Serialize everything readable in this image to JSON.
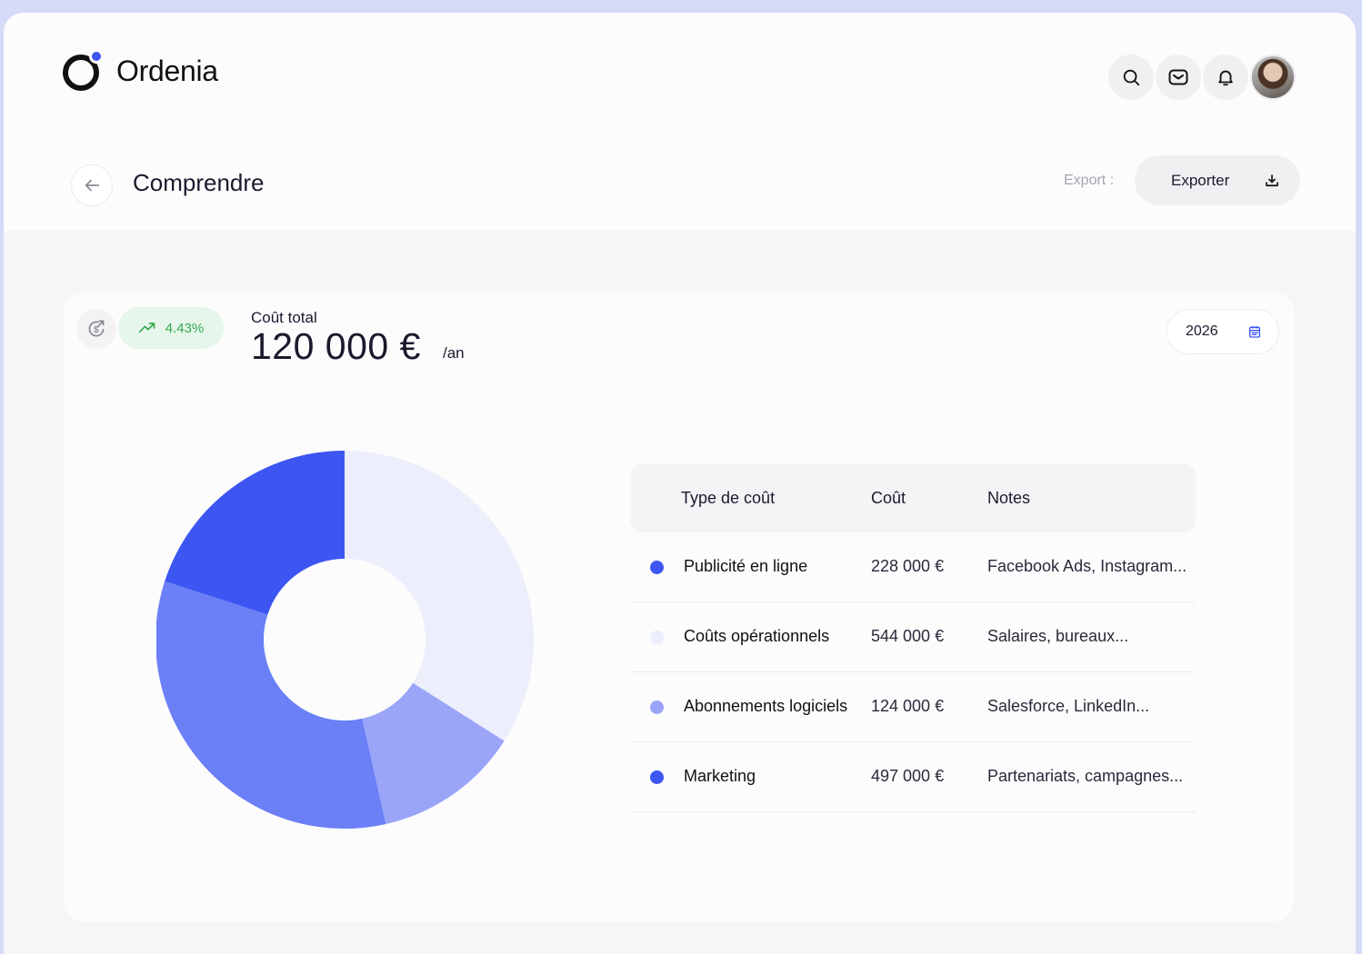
{
  "app": {
    "name": "Ordenia"
  },
  "header": {
    "page_title": "Comprendre",
    "export_label": "Export :",
    "export_button": "Exporter"
  },
  "summary": {
    "trend": "4.43%",
    "total_label": "Coût total",
    "total_value": "120 000 €",
    "total_unit": "/an",
    "year": "2026"
  },
  "table": {
    "headers": {
      "type": "Type de coût",
      "cost": "Coût",
      "notes": "Notes"
    },
    "rows": [
      {
        "type": "Publicité en ligne",
        "cost": "228 000 €",
        "notes": "Facebook Ads, Instagram...",
        "color": "#3d56f2"
      },
      {
        "type": "Coûts opérationnels",
        "cost": "544 000 €",
        "notes": "Salaires, bureaux...",
        "color": "#eceefc"
      },
      {
        "type": "Abonnements logiciels",
        "cost": "124 000 €",
        "notes": "Salesforce, LinkedIn...",
        "color": "#9aa5f8"
      },
      {
        "type": "Marketing",
        "cost": "497 000 €",
        "notes": "Partenariats, campagnes...",
        "color": "#3d56f2"
      }
    ]
  },
  "chart_data": {
    "type": "pie",
    "hole": true,
    "slices": [
      {
        "label": "Coûts opérationnels",
        "value": 34,
        "color": "#eceefc"
      },
      {
        "label": "Abonnements logiciels",
        "value": 12.5,
        "color": "#9aa5f8"
      },
      {
        "label": "Marketing",
        "value": 33.5,
        "color": "#6b80f6"
      },
      {
        "label": "Publicité en ligne",
        "value": 20,
        "color": "#3d56f2"
      }
    ]
  }
}
